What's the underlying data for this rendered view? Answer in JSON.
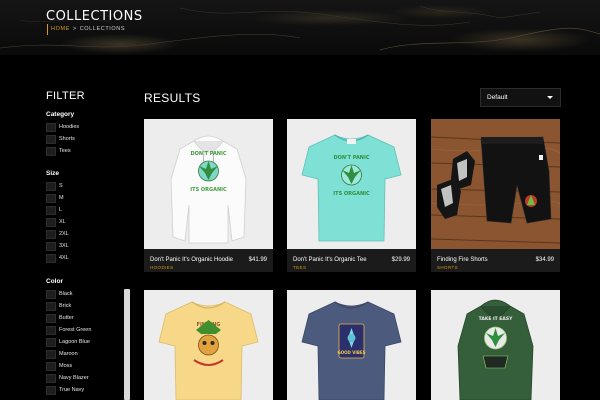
{
  "header": {
    "title": "COLLECTIONS",
    "breadcrumb": {
      "home": "HOME",
      "separator": ">",
      "current": "COLLECTIONS"
    }
  },
  "filter": {
    "title": "FILTER",
    "category": {
      "title": "Category",
      "options": [
        "Hoodies",
        "Shorts",
        "Tees"
      ]
    },
    "size": {
      "title": "Size",
      "options": [
        "S",
        "M",
        "L",
        "XL",
        "2XL",
        "3XL",
        "4XL"
      ]
    },
    "color": {
      "title": "Color",
      "options": [
        "Black",
        "Brick",
        "Butter",
        "Forest Green",
        "Lagoon Blue",
        "Maroon",
        "Moss",
        "Navy Blazer",
        "True Navy"
      ]
    }
  },
  "results": {
    "title": "RESULTS",
    "sort": {
      "selected": "Default"
    },
    "products": [
      {
        "name": "Don't Panic It's Organic Hoodie",
        "price": "$41.99",
        "category": "HOODIES",
        "image": "white-hoodie"
      },
      {
        "name": "Don't Panic It's Organic Tee",
        "price": "$29.99",
        "category": "TEES",
        "image": "mint-tee"
      },
      {
        "name": "Finding Fire Shorts",
        "price": "$34.99",
        "category": "SHORTS",
        "image": "black-shorts-on-wood"
      },
      {
        "image": "butter-tee"
      },
      {
        "image": "navy-tee"
      },
      {
        "image": "forest-green-hoodie"
      }
    ]
  },
  "colors": {
    "accent": "#d49a1d",
    "background": "#000000",
    "card_info": "#1b1b1b"
  }
}
